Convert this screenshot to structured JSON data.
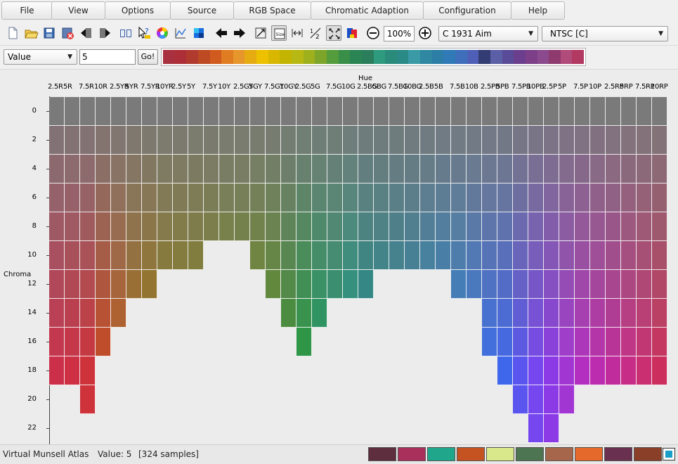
{
  "menu": [
    "File",
    "View",
    "Options",
    "Source",
    "RGB Space",
    "Chromatic Adaption",
    "Configuration",
    "Help"
  ],
  "toolbar": {
    "zoom": "100%",
    "illuminant_select": "C 1931 Aim",
    "rgb_space_select": "NTSC [C]",
    "icons": [
      "new-file-icon",
      "open-folder-icon",
      "save-icon",
      "close-file-icon",
      "import-icon",
      "export-icon",
      "book-icon",
      "help-cursor-icon",
      "color-wheel-icon",
      "chart-icon",
      "swatch-icon",
      "arrow-left-icon",
      "arrow-right-icon",
      "rotate-icon",
      "size-icon",
      "width-icon",
      "half-icon",
      "fit-icon",
      "palette-icon",
      "zoom-out-icon",
      "zoom-in-icon"
    ]
  },
  "filter": {
    "type_select": "Value",
    "value_input": "5",
    "go_label": "Go!"
  },
  "hue_strip": [
    "#a8303f",
    "#ac2f37",
    "#b13a2f",
    "#bd4a22",
    "#d15b1f",
    "#e07c22",
    "#e6962a",
    "#e7ab12",
    "#edc000",
    "#d9b700",
    "#c2b400",
    "#b8b815",
    "#9eb01c",
    "#7da52a",
    "#549c3c",
    "#3a8f48",
    "#2a8454",
    "#2a7e5b",
    "#2e9a7e",
    "#2a8b7b",
    "#2a8a86",
    "#3a9aa5",
    "#2f87a1",
    "#2d7ea6",
    "#2f7ab7",
    "#3f6fbb",
    "#4f5fb7",
    "#333d73",
    "#5b5fa6",
    "#5a4b98",
    "#6b3e8e",
    "#7c3f88",
    "#8b4a8d",
    "#8f3a6f",
    "#b04b7a",
    "#b23961"
  ],
  "axis": {
    "hue_title": "Hue",
    "chroma_title": "Chroma",
    "hue_labels": [
      "2.5R",
      "5R",
      "7.5R",
      "10R",
      "2.5YR",
      "5YR",
      "7.5YR",
      "10YR",
      "2.5Y",
      "5Y",
      "7.5Y",
      "10Y",
      "2.5GY",
      "5GY",
      "7.5GY",
      "10GY",
      "2.5G",
      "5G",
      "7.5G",
      "10G",
      "2.5BG",
      "5BG",
      "7.5BG",
      "10BG",
      "2.5B",
      "5B",
      "7.5B",
      "10B",
      "2.5PB",
      "5PB",
      "7.5PB",
      "10PB",
      "2.5P",
      "5P",
      "7.5P",
      "10P",
      "2.5RP",
      "5RP",
      "7.5RP",
      "10RP"
    ],
    "chroma_labels": [
      "0",
      "2",
      "4",
      "6",
      "8",
      "10",
      "12",
      "14",
      "16",
      "18",
      "20",
      "22"
    ]
  },
  "atlas": {
    "max_chroma": [
      18,
      18,
      20,
      16,
      14,
      12,
      12,
      10,
      10,
      10,
      8,
      8,
      8,
      10,
      12,
      14,
      16,
      14,
      12,
      12,
      12,
      10,
      10,
      10,
      10,
      10,
      12,
      12,
      16,
      18,
      20,
      22,
      22,
      20,
      18,
      18,
      18,
      18,
      18,
      18
    ],
    "hue_colors": [
      "#cc2f4a",
      "#cd3043",
      "#ce323b",
      "#c84620",
      "#bd5a1c",
      "#a86a12",
      "#a0720d",
      "#917a10",
      "#8c7e0f",
      "#857f10",
      "#7e8212",
      "#768813",
      "#6f8914",
      "#668d14",
      "#568f1e",
      "#3f9130",
      "#269a42",
      "#1a9c5b",
      "#1c9a6b",
      "#139d80",
      "#138e8a",
      "#168c93",
      "#1a889e",
      "#1e85ab",
      "#1f86bb",
      "#2283cb",
      "#2a80d4",
      "#3278e0",
      "#3b6ee8",
      "#3f67ec",
      "#5a55ee",
      "#7646ee",
      "#8c3ae6",
      "#a236d3",
      "#b22fc0",
      "#bb2cae",
      "#c02c9b",
      "#c72d86",
      "#ca2f72",
      "#cc2f5e"
    ]
  },
  "status": {
    "app_name": "Virtual Munsell Atlas",
    "value_text": "Value: 5",
    "samples_text": "[324 samples]",
    "swatches": [
      "#5e2e3e",
      "#a8305a",
      "#20a68a",
      "#c45321",
      "#d8e88a",
      "#4d7552",
      "#a5664b",
      "#e5692a",
      "#6a3050",
      "#8a4028"
    ]
  }
}
